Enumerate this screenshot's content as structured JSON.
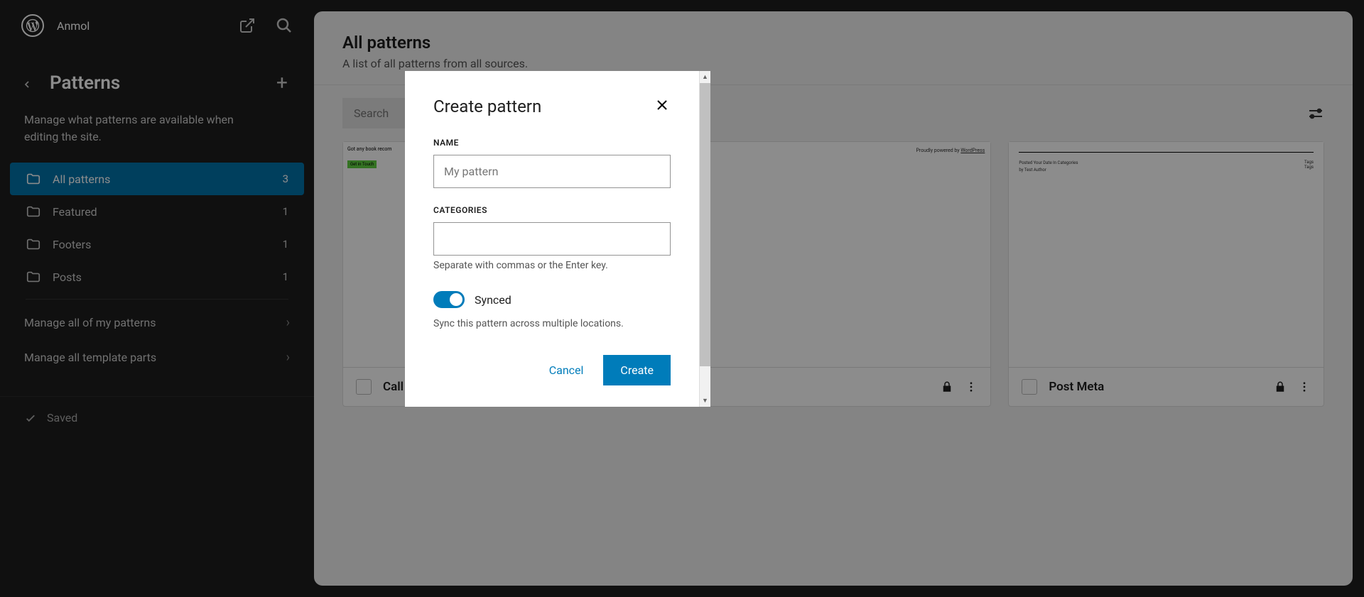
{
  "header": {
    "site_name": "Anmol"
  },
  "sidebar": {
    "title": "Patterns",
    "description": "Manage what patterns are available when editing the site.",
    "items": [
      {
        "label": "All patterns",
        "count": "3",
        "active": true
      },
      {
        "label": "Featured",
        "count": "1",
        "active": false
      },
      {
        "label": "Footers",
        "count": "1",
        "active": false
      },
      {
        "label": "Posts",
        "count": "1",
        "active": false
      }
    ],
    "manage": [
      {
        "label": "Manage all of my patterns"
      },
      {
        "label": "Manage all template parts"
      }
    ],
    "saved_label": "Saved"
  },
  "main": {
    "title": "All patterns",
    "subtitle": "A list of all patterns from all sources.",
    "search_placeholder": "Search",
    "cards": [
      {
        "title": "Call t",
        "preview_type": "p1",
        "p1_text": "Got any book recom",
        "p1_btn": "Get in Touch"
      },
      {
        "title": "",
        "preview_type": "p2",
        "p2_text": "Proudly powered by WordPress"
      },
      {
        "title": "Post Meta",
        "preview_type": "p3",
        "p3_l1": "Posted Your Date In Categories",
        "p3_l2": "by Test Author",
        "p3_r": "Tags"
      }
    ]
  },
  "modal": {
    "title": "Create pattern",
    "name_label": "NAME",
    "name_placeholder": "My pattern",
    "categories_label": "CATEGORIES",
    "categories_hint": "Separate with commas or the Enter key.",
    "synced_label": "Synced",
    "synced_hint": "Sync this pattern across multiple locations.",
    "cancel": "Cancel",
    "create": "Create"
  }
}
